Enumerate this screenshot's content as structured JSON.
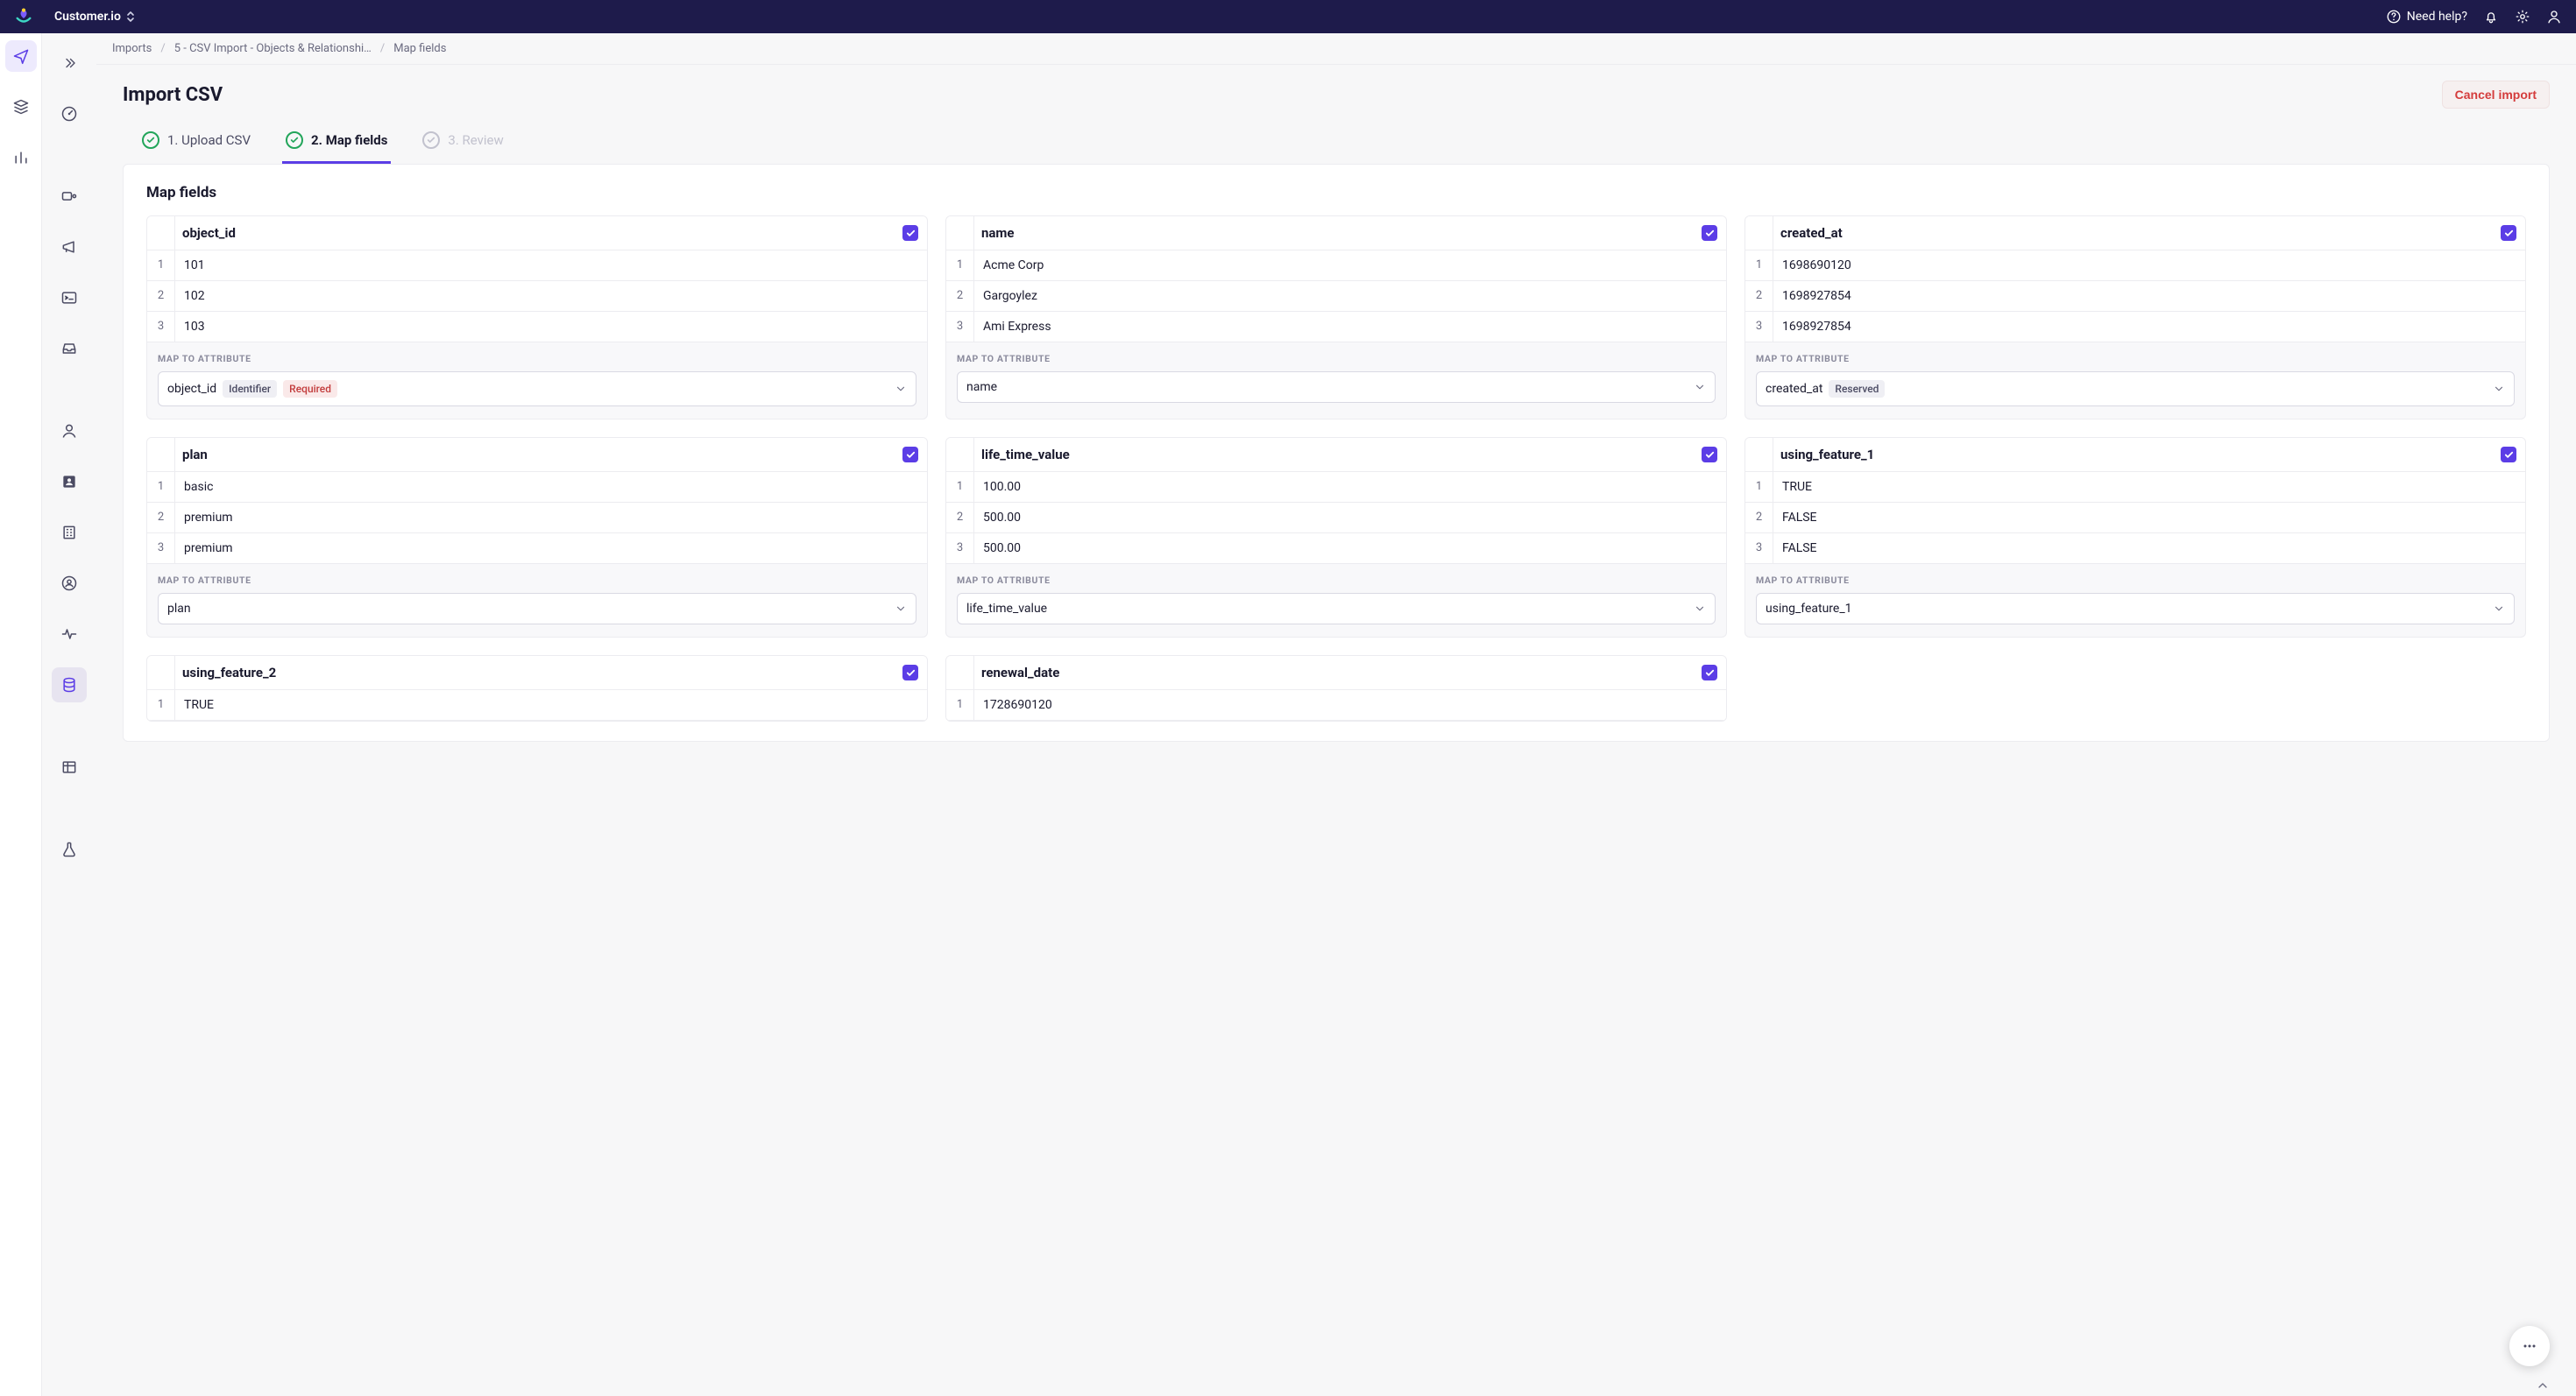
{
  "topbar": {
    "workspace": "Customer.io",
    "help": "Need help?"
  },
  "breadcrumbs": {
    "a": "Imports",
    "b": "5 - CSV Import - Objects & Relationshi…",
    "c": "Map fields"
  },
  "page": {
    "title": "Import CSV",
    "cancel": "Cancel import",
    "section": "Map fields",
    "map_label": "MAP TO ATTRIBUTE"
  },
  "steps": {
    "s1": "1. Upload CSV",
    "s2": "2. Map fields",
    "s3": "3. Review"
  },
  "badges": {
    "identifier": "Identifier",
    "required": "Required",
    "reserved": "Reserved"
  },
  "cards": [
    {
      "name": "object_id",
      "rows": [
        "101",
        "102",
        "103"
      ],
      "attr": "object_id",
      "badges": [
        "identifier",
        "required"
      ]
    },
    {
      "name": "name",
      "rows": [
        "Acme Corp",
        "Gargoylez",
        "Ami Express"
      ],
      "attr": "name",
      "badges": []
    },
    {
      "name": "created_at",
      "rows": [
        "1698690120",
        "1698927854",
        "1698927854"
      ],
      "attr": "created_at",
      "badges": [
        "reserved"
      ]
    },
    {
      "name": "plan",
      "rows": [
        "basic",
        "premium",
        "premium"
      ],
      "attr": "plan",
      "badges": []
    },
    {
      "name": "life_time_value",
      "rows": [
        "100.00",
        "500.00",
        "500.00"
      ],
      "attr": "life_time_value",
      "badges": []
    },
    {
      "name": "using_feature_1",
      "rows": [
        "TRUE",
        "FALSE",
        "FALSE"
      ],
      "attr": "using_feature_1",
      "badges": []
    },
    {
      "name": "using_feature_2",
      "rows": [
        "TRUE"
      ],
      "attr": "",
      "badges": [],
      "partial": true
    },
    {
      "name": "renewal_date",
      "rows": [
        "1728690120"
      ],
      "attr": "",
      "badges": [],
      "partial": true
    }
  ]
}
